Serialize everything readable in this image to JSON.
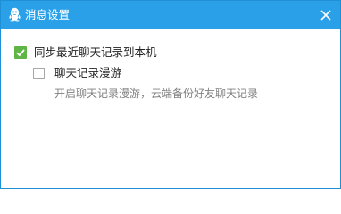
{
  "window": {
    "title": "消息设置",
    "logo_icon": "qq-penguin-icon",
    "close_icon": "close-icon"
  },
  "settings": {
    "sync_history": {
      "label": "同步最近聊天记录到本机",
      "checked": true
    },
    "roam_history": {
      "label": "聊天记录漫游",
      "checked": false,
      "description": "开启聊天记录漫游，云端备份好友聊天记录"
    }
  },
  "colors": {
    "titlebar": "#2aa0e8",
    "border": "#1f8fd6",
    "checkbox_checked": "#5fb646",
    "text": "#222222",
    "description_text": "#808080"
  }
}
